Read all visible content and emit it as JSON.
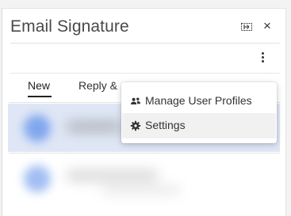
{
  "panel": {
    "title": "Email Signature",
    "pin_icon": "pin-panel-icon",
    "close_icon": "close-icon",
    "close_glyph": "×",
    "more_icon": "more-vertical-icon"
  },
  "tabs": [
    {
      "label": "New",
      "selected": true
    },
    {
      "label": "Reply &",
      "selected": false
    }
  ],
  "menu": {
    "items": [
      {
        "label": "Manage User Profiles",
        "icon": "users-icon"
      },
      {
        "label": "Settings",
        "icon": "gear-icon",
        "hovered": true
      }
    ]
  },
  "colors": {
    "selected_row": "#dfe7f6",
    "menu_hover": "#f1f1f1",
    "text": "#333333",
    "title": "#4a4a4a"
  }
}
